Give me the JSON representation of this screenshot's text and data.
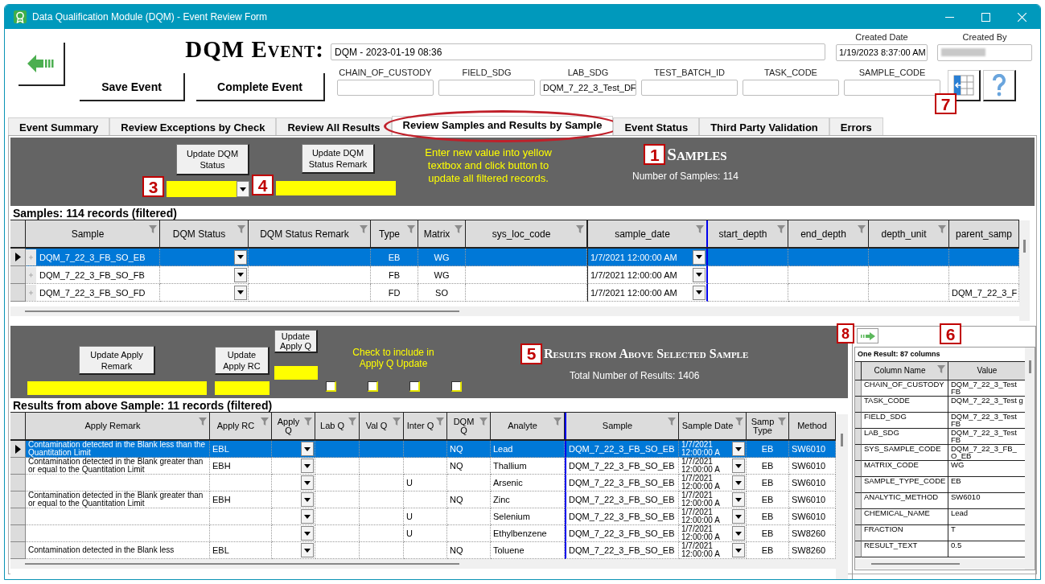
{
  "window": {
    "title": "Data Qualification Module (DQM) - Event Review Form"
  },
  "event": {
    "heading": "DQM Event:",
    "name": "DQM - 2023-01-19 08:36",
    "created_date": {
      "label": "Created Date",
      "value": "1/19/2023 8:37:00 AM"
    },
    "created_by": {
      "label": "Created By"
    }
  },
  "actions": [
    "Save Event",
    "Complete Event"
  ],
  "filters": [
    {
      "label": "CHAIN_OF_CUSTODY"
    },
    {
      "label": "FIELD_SDG"
    },
    {
      "label": "LAB_SDG",
      "value": "DQM_7_22_3_Test_DF"
    },
    {
      "label": "TEST_BATCH_ID"
    },
    {
      "label": "TASK_CODE"
    },
    {
      "label": "SAMPLE_CODE"
    }
  ],
  "toolbar": {
    "callout": "7"
  },
  "tabs": [
    {
      "label": "Event Summary",
      "selected": false,
      "circled": false
    },
    {
      "label": "Review Exceptions by Check",
      "selected": false,
      "circled": false
    },
    {
      "label": "Review All Results",
      "selected": false,
      "circled": false
    },
    {
      "label": "Review Samples and Results by Sample",
      "selected": true,
      "circled": true
    },
    {
      "label": "Event Status",
      "selected": false,
      "circled": false
    },
    {
      "label": "Third Party Validation",
      "selected": false,
      "circled": false
    },
    {
      "label": "Errors",
      "selected": false,
      "circled": false
    }
  ],
  "samples": {
    "status_button": "Update DQM Status",
    "status_callout": "3",
    "remark_button": "Update DQM Status Remark",
    "remark_callout": "4",
    "instructions": "Enter new value into yellow textbox and click button to update all filtered records.",
    "callout": "1",
    "title": "Samples",
    "count": "Number of Samples: 114",
    "caption": "Samples: 114 records (filtered)",
    "columns": [
      {
        "label": "Sample",
        "kind": "expand",
        "filter": true,
        "frozen": false
      },
      {
        "label": "DQM Status",
        "kind": "dropdown",
        "filter": true,
        "frozen": false
      },
      {
        "label": "DQM Status Remark",
        "kind": "text",
        "filter": true,
        "frozen": false
      },
      {
        "label": "Type",
        "kind": "code",
        "filter": true,
        "frozen": false
      },
      {
        "label": "Matrix",
        "kind": "code",
        "filter": true,
        "frozen": false
      },
      {
        "label": "sys_loc_code",
        "kind": "text",
        "filter": true,
        "frozen": false
      },
      {
        "label": "sample_date",
        "kind": "dropdown",
        "filter": true,
        "frozen": true
      },
      {
        "label": "start_depth",
        "kind": "text",
        "filter": true,
        "frozen": false
      },
      {
        "label": "end_depth",
        "kind": "text",
        "filter": true,
        "frozen": false
      },
      {
        "label": "depth_unit",
        "kind": "text",
        "filter": true,
        "frozen": false
      },
      {
        "label": "parent_samp",
        "kind": "text",
        "filter": false,
        "frozen": false
      }
    ],
    "rows": [
      {
        "selected": true,
        "cells": [
          "DQM_7_22_3_FB_SO_EB",
          null,
          null,
          "EB",
          "WG",
          null,
          "1/7/2021 12:00:00 AM",
          null,
          null,
          null,
          null
        ]
      },
      {
        "selected": false,
        "cells": [
          "DQM_7_22_3_FB_SO_FB",
          null,
          null,
          "FB",
          "WG",
          null,
          "1/7/2021 12:00:00 AM",
          null,
          null,
          null,
          null
        ]
      },
      {
        "selected": false,
        "cells": [
          "DQM_7_22_3_FB_SO_FD",
          null,
          null,
          "FD",
          "SO",
          null,
          "1/7/2021 12:00:00 AM",
          null,
          null,
          null,
          "DQM_7_22_3_F"
        ]
      }
    ]
  },
  "results": {
    "buttons": [
      "Update Apply Remark",
      "Update Apply RC",
      "Update Apply Q"
    ],
    "check_hint": "Check to include in Apply Q Update",
    "checks": [
      {
        "checked": false
      },
      {
        "checked": false
      },
      {
        "checked": false
      },
      {
        "checked": false
      }
    ],
    "callout": "5",
    "title": "Results from Above Selected Sample",
    "count": "Total Number of Results: 1406",
    "caption": "Results from above Sample: 11 records (filtered)",
    "columns": [
      {
        "label": "Apply Remark",
        "kind": "wrap",
        "filter": true,
        "frozen": false
      },
      {
        "label": "Apply RC",
        "kind": "text",
        "filter": true,
        "frozen": false
      },
      {
        "label": "Apply Q",
        "kind": "dropdown",
        "filter": true,
        "frozen": false
      },
      {
        "label": "Lab Q",
        "kind": "text",
        "filter": true,
        "frozen": false
      },
      {
        "label": "Val Q",
        "kind": "text",
        "filter": true,
        "frozen": false
      },
      {
        "label": "Inter Q",
        "kind": "text",
        "filter": true,
        "frozen": false
      },
      {
        "label": "DQM Q",
        "kind": "text",
        "filter": true,
        "frozen": false
      },
      {
        "label": "Analyte",
        "kind": "text",
        "filter": true,
        "frozen": false
      },
      {
        "label": "Sample",
        "kind": "text",
        "filter": true,
        "frozen": true
      },
      {
        "label": "Sample Date",
        "kind": "wrapdrop",
        "filter": true,
        "frozen": false
      },
      {
        "label": "Samp Type",
        "kind": "code",
        "filter": true,
        "frozen": false
      },
      {
        "label": "Method",
        "kind": "text",
        "filter": false,
        "frozen": false
      }
    ],
    "rows": [
      {
        "selected": true,
        "cells": [
          "Contamination detected in the Blank less than the Quantitation Limit",
          "EBL",
          null,
          null,
          null,
          null,
          "NQ",
          "Lead",
          "DQM_7_22_3_FB_SO_EB",
          "1/7/2021 12:00:00 A",
          "EB",
          "SW6010"
        ]
      },
      {
        "selected": false,
        "cells": [
          "Contamination detected in the Blank greater than or equal to the Quantitation Limit",
          "EBH",
          null,
          null,
          null,
          null,
          "NQ",
          "Thallium",
          "DQM_7_22_3_FB_SO_EB",
          "1/7/2021 12:00:00 A",
          "EB",
          "SW6010"
        ]
      },
      {
        "selected": false,
        "cells": [
          null,
          null,
          null,
          null,
          null,
          "U",
          null,
          "Arsenic",
          "DQM_7_22_3_FB_SO_EB",
          "1/7/2021 12:00:00 A",
          "EB",
          "SW6010"
        ]
      },
      {
        "selected": false,
        "cells": [
          "Contamination detected in the Blank greater than or equal to the Quantitation Limit",
          "EBH",
          null,
          null,
          null,
          null,
          "NQ",
          "Zinc",
          "DQM_7_22_3_FB_SO_EB",
          "1/7/2021 12:00:00 A",
          "EB",
          "SW6010"
        ]
      },
      {
        "selected": false,
        "cells": [
          null,
          null,
          null,
          null,
          null,
          "U",
          null,
          "Selenium",
          "DQM_7_22_3_FB_SO_EB",
          "1/7/2021 12:00:00 A",
          "EB",
          "SW6010"
        ]
      },
      {
        "selected": false,
        "cells": [
          null,
          null,
          null,
          null,
          null,
          "U",
          null,
          "Ethylbenzene",
          "DQM_7_22_3_FB_SO_EB",
          "1/7/2021 12:00:00 A",
          "EB",
          "SW8260"
        ]
      },
      {
        "selected": false,
        "cells": [
          "Contamination detected in the Blank less",
          "EBL",
          null,
          null,
          null,
          null,
          "NQ",
          "Toluene",
          "DQM_7_22_3_FB_SO_EB",
          "1/7/2021 12:00:00 A",
          "EB",
          "SW8260"
        ]
      }
    ]
  },
  "detail": {
    "arrow_callout": "8",
    "callout": "6",
    "caption": "One Result: 87 columns",
    "columns": [
      {
        "label": "Column Name",
        "filter": true
      },
      {
        "label": "Value",
        "filter": false
      }
    ],
    "rows": [
      [
        "CHAIN_OF_CUSTODY",
        "DQM_7_22_3_Test FB"
      ],
      [
        "TASK_CODE",
        "DQM_7_22_3_Test g"
      ],
      [
        "FIELD_SDG",
        "DQM_7_22_3_Test FB"
      ],
      [
        "LAB_SDG",
        "DQM_7_22_3_Test FB"
      ],
      [
        "SYS_SAMPLE_CODE",
        "DQM_7_22_3_FB_ O_EB"
      ],
      [
        "MATRIX_CODE",
        "WG"
      ],
      [
        "SAMPLE_TYPE_CODE",
        "EB"
      ],
      [
        "ANALYTIC_METHOD",
        "SW6010"
      ],
      [
        "CHEMICAL_NAME",
        "Lead"
      ],
      [
        "FRACTION",
        "T"
      ],
      [
        "RESULT_TEXT",
        "0.5"
      ]
    ]
  }
}
